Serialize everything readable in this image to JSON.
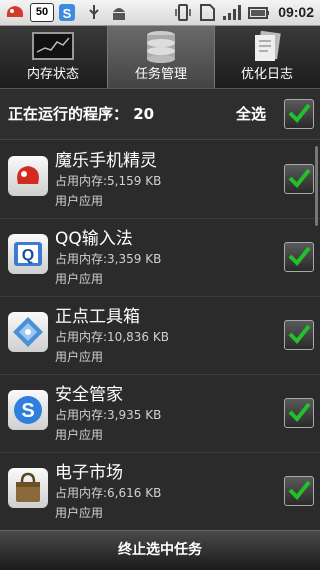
{
  "statusbar": {
    "badge_count": "50",
    "time": "09:02",
    "icons": [
      "notification-app-icon",
      "badge-icon",
      "shield-s-icon",
      "usb-icon",
      "android-icon",
      "vibrate-icon",
      "sd-card-icon",
      "signal-icon",
      "battery-icon"
    ]
  },
  "tabs": [
    {
      "label": "内存状态",
      "icon": "chart-icon"
    },
    {
      "label": "任务管理",
      "icon": "database-icon"
    },
    {
      "label": "优化日志",
      "icon": "documents-icon"
    }
  ],
  "header": {
    "running_label": "正在运行的程序：",
    "running_count": "20",
    "select_all_label": "全选"
  },
  "apps": [
    {
      "name": "魔乐手机精灵",
      "memory": "占用内存:5,159 KB",
      "type": "用户应用",
      "icon": "red-bird-icon",
      "checked": true
    },
    {
      "name": "QQ输入法",
      "memory": "占用内存:3,359 KB",
      "type": "用户应用",
      "icon": "keyboard-q-icon",
      "checked": true
    },
    {
      "name": "正点工具箱",
      "memory": "占用内存:10,836 KB",
      "type": "用户应用",
      "icon": "toolbox-icon",
      "checked": true
    },
    {
      "name": "安全管家",
      "memory": "占用内存:3,935 KB",
      "type": "用户应用",
      "icon": "shield-s-icon",
      "checked": true
    },
    {
      "name": "电子市场",
      "memory": "占用内存:6,616 KB",
      "type": "用户应用",
      "icon": "shopping-bag-icon",
      "checked": true
    }
  ],
  "bottom_button": "终止选中任务",
  "colors": {
    "check": "#22c02a",
    "background": "#2b2b2b"
  }
}
